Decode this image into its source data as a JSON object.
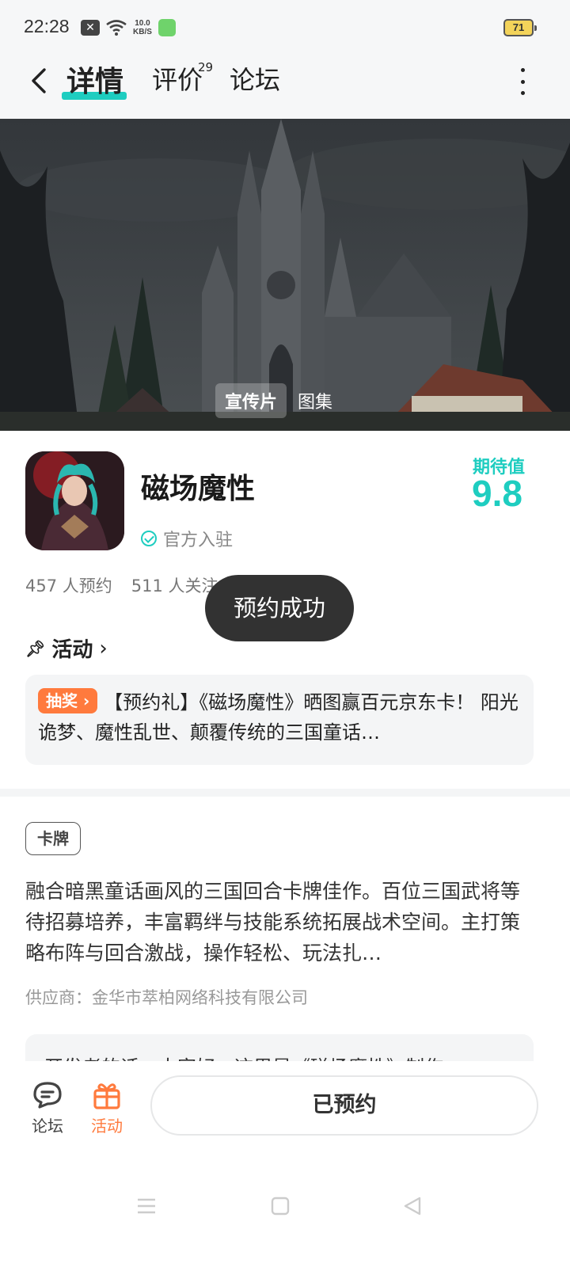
{
  "status_bar": {
    "time": "22:28",
    "speed_value": "10.0",
    "speed_unit": "KB/S",
    "battery": "71"
  },
  "header": {
    "tabs": [
      {
        "label": "详情",
        "active": true
      },
      {
        "label": "评价",
        "count": "29"
      },
      {
        "label": "论坛"
      }
    ]
  },
  "banner": {
    "media_tabs": [
      "宣传片",
      "图集"
    ]
  },
  "game": {
    "name": "磁场魔性",
    "official_label": "官方入驻",
    "expect_label": "期待值",
    "expect_value": "9.8",
    "reservations": "457 人预约",
    "followers": "511 人关注"
  },
  "toast": "预约成功",
  "activity": {
    "title": "活动",
    "badge": "抽奖",
    "text": "【预约礼】《磁场魔性》晒图赢百元京东卡！ 阳光诡梦、魔性乱世、颠覆传统的三国童话…"
  },
  "description": {
    "genre": "卡牌",
    "text": "融合暗黑童话画风的三国回合卡牌佳作。百位三国武将等待招募培养，丰富羁绊与技能系统拓展战术空间。主打策略布阵与回合激战，操作轻松、玩法扎…",
    "supplier": "供应商：金华市萃柏网络科技有限公司",
    "dev_note": "开发者的话：大家好，这里是《磁场魔性》制作"
  },
  "bottom_bar": {
    "forum_label": "论坛",
    "activity_label": "活动",
    "reserved_label": "已预约"
  },
  "colors": {
    "accent": "#1ecdc0",
    "orange": "#ff7a3d",
    "toast_bg": "#323232"
  }
}
